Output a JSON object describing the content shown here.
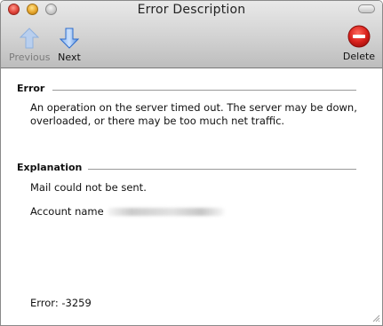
{
  "window": {
    "title": "Error Description"
  },
  "toolbar": {
    "previous_label": "Previous",
    "next_label": "Next",
    "delete_label": "Delete"
  },
  "error_section": {
    "heading": "Error",
    "message_line1": "An operation on the server timed out. The server may be down,",
    "message_line2": "overloaded, or there may be too much net traffic."
  },
  "explanation_section": {
    "heading": "Explanation",
    "detail": "Mail could not be sent.",
    "account_label": "Account name"
  },
  "error_code": "Error: -3259",
  "colors": {
    "arrow_blue": "#3d7fe0",
    "disabled_arrow": "#a9c3e6",
    "delete_red": "#d8201b"
  }
}
